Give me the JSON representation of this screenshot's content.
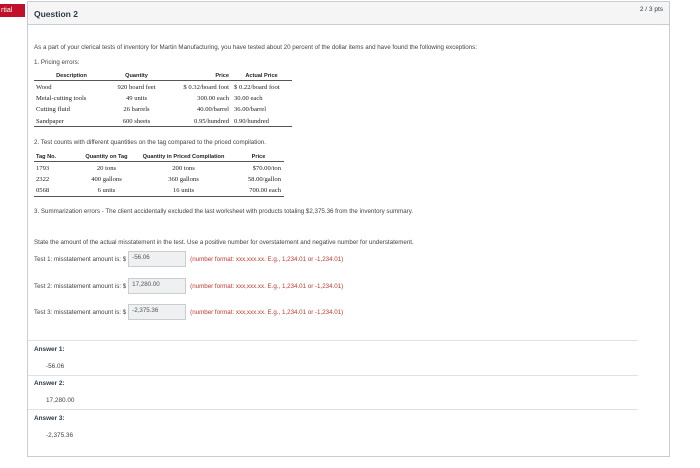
{
  "partial_tag": "rtial",
  "question": {
    "title": "Question 2",
    "points": "2 / 3 pts",
    "intro": "As a part of your clerical tests of inventory for Martin Manufacturing, you have tested about 20 percent of the dollar items and have found the following exceptions:",
    "section1_title": "1. Pricing errors:",
    "pricing_table": {
      "headers": [
        "Description",
        "Quantity",
        "Price",
        "Actual Price"
      ],
      "rows": [
        [
          "Wood",
          "920 board feet",
          "$ 0.32/board foot",
          "$ 0.22/board foot"
        ],
        [
          "Metal-cutting tools",
          "49 units",
          "300.00 each",
          "30.00 each"
        ],
        [
          "Cutting fluid",
          "26 barrels",
          "40.00/barrel",
          "36.00/barrel"
        ],
        [
          "Sandpaper",
          "600 sheets",
          "0.95/hundred",
          "0.90/hundred"
        ]
      ]
    },
    "section2_title": "2. Test counts with different quantities on the tag compared to the priced compilation.",
    "counts_table": {
      "headers": [
        "Tag No.",
        "Quantity on Tag",
        "Quantity in Priced Compilation",
        "Price"
      ],
      "rows": [
        [
          "1793",
          "20 tons",
          "200 tons",
          "$70.00/ton"
        ],
        [
          "2322",
          "400 gallons",
          "360 gallons",
          "58.00/gallon"
        ],
        [
          "0568",
          "6 units",
          "16 units",
          "700.00 each"
        ]
      ]
    },
    "section3_text": "3. Summarization errors - The client accidentally excluded the last worksheet with products totaling $2,375.36 from the inventory summary.",
    "instruction": "State the amount of the actual misstatement in the test. Use a positive number for overstatement and negative number for understatement.",
    "inputs": [
      {
        "label": "Test 1: misstatement amount is: $",
        "value": "-56.06",
        "format": "(number format: xxx,xxx.xx. E.g., 1,234.01 or -1,234.01)"
      },
      {
        "label": "Test 2: misstatement amount is: $",
        "value": "17,280.00",
        "format": "(number format: xxx,xxx.xx. E.g., 1,234.01 or -1,234.01)"
      },
      {
        "label": "Test 3: misstatement amount is: $",
        "value": "-2,375.36",
        "format": "(number format: xxx,xxx.xx. E.g., 1,234.01 or -1,234.01)"
      }
    ],
    "answers": [
      {
        "label": "Answer 1:",
        "value": "-56.06"
      },
      {
        "label": "Answer 2:",
        "value": "17,280.00"
      },
      {
        "label": "Answer 3:",
        "value": "-2,375.36"
      }
    ]
  },
  "colors": {
    "partial_tag": "#c0102a",
    "format_hint": "#c0392b",
    "border": "#c7cdd1"
  }
}
